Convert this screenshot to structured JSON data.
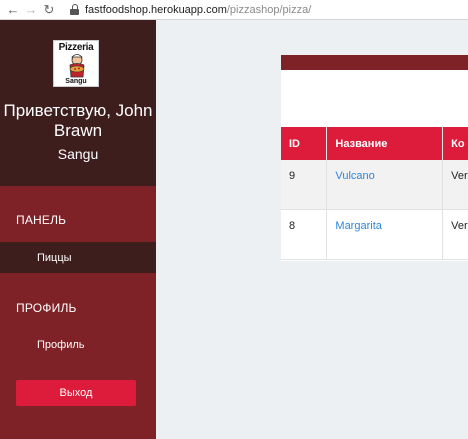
{
  "browser": {
    "url_host": "fastfoodshop.herokuapp.com",
    "url_path": "/pizzashop/pizza/"
  },
  "logo": {
    "top_text": "Pizzeria",
    "bottom_text": "Sangu"
  },
  "sidebar": {
    "greeting_line1": "Приветствую, John",
    "greeting_line2": "Brawn",
    "shop_name": "Sangu",
    "sections": [
      {
        "label": "ПАНЕЛЬ",
        "items": [
          {
            "label": "Пиццы",
            "active": true
          }
        ]
      },
      {
        "label": "ПРОФИЛЬ",
        "items": [
          {
            "label": "Профиль",
            "active": false
          }
        ]
      }
    ],
    "logout_label": "Выход"
  },
  "table": {
    "headers": [
      "ID",
      "Название",
      "Ко"
    ],
    "rows": [
      {
        "id": "9",
        "name": "Vulcano",
        "comp": "Ver"
      },
      {
        "id": "8",
        "name": "Margarita",
        "comp": "Ver"
      }
    ]
  },
  "colors": {
    "sidebar_bg": "#7f2227",
    "sidebar_dark": "#3d1e1d",
    "accent_red": "#dc1c3a",
    "link_blue": "#2e86de",
    "main_bg": "#ecf0f3"
  }
}
